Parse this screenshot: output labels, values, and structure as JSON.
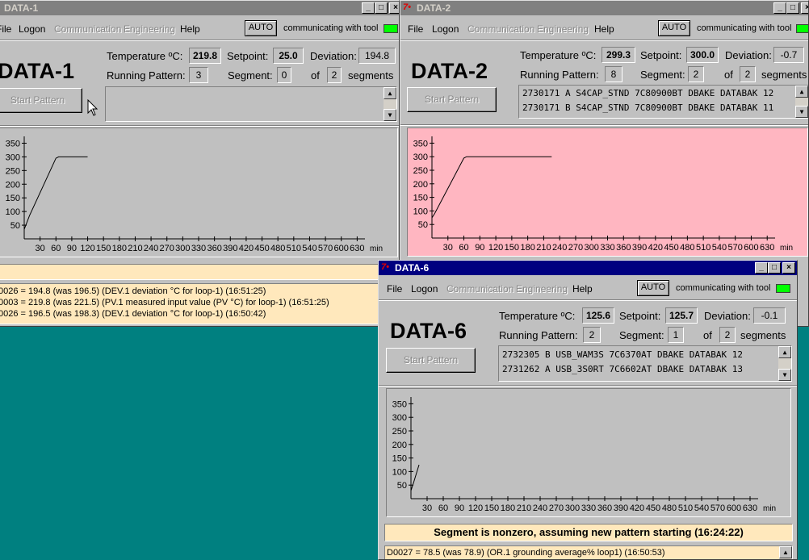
{
  "menu": {
    "file": "File",
    "logon": "Logon",
    "communication": "Communication",
    "engineering": "Engineering",
    "help": "Help"
  },
  "labels": {
    "temperature": "Temperature ºC:",
    "setpoint": "Setpoint:",
    "deviation": "Deviation:",
    "running_pattern": "Running Pattern:",
    "segment": "Segment:",
    "of": "of",
    "segments": "segments",
    "auto": "AUTO",
    "status": "communicating with tool",
    "start_pattern": "Start Pattern"
  },
  "title_buttons": {
    "minimize": "_",
    "maximize": "□",
    "close": "×"
  },
  "window1": {
    "title": "DATA-1",
    "heading": "DATA-1",
    "temperature": "219.8",
    "setpoint": "25.0",
    "deviation": "194.8",
    "running_pattern": "3",
    "segment": "0",
    "of_segments": "2",
    "pattern_rows": [
      "",
      ""
    ],
    "log": [
      "0026 = 194.8 (was 196.5) (DEV.1 deviation °C for loop-1) (16:51:25)",
      "0003 = 219.8 (was 221.5) (PV.1 measured input value (PV °C) for loop-1) (16:51:25)",
      "0026 = 196.5 (was 198.3) (DEV.1 deviation °C for loop-1) (16:50:42)"
    ],
    "chart": {
      "bg": "#c0c0c0",
      "y_ticks": [
        "50",
        "100",
        "150",
        "200",
        "250",
        "300",
        "350"
      ],
      "x_ticks": [
        "30",
        "60",
        "90",
        "120",
        "150",
        "180",
        "210",
        "240",
        "270",
        "300",
        "330",
        "360",
        "390",
        "420",
        "450",
        "480",
        "510",
        "540",
        "570",
        "600",
        "630"
      ],
      "x_unit": "min"
    }
  },
  "window2": {
    "title": "DATA-2",
    "heading": "DATA-2",
    "temperature": "299.3",
    "setpoint": "300.0",
    "deviation": "-0.7",
    "running_pattern": "8",
    "segment": "2",
    "of_segments": "2",
    "pattern_rows": [
      "2730171 A S4CAP_STND 7C80900BT DBAKE DATABAK 12",
      "2730171 B S4CAP_STND 7C80900BT DBAKE DATABAK 11"
    ],
    "chart": {
      "bg": "#ffb6c1",
      "y_ticks": [
        "50",
        "100",
        "150",
        "200",
        "250",
        "300",
        "350"
      ],
      "x_ticks": [
        "30",
        "60",
        "90",
        "120",
        "150",
        "180",
        "210",
        "240",
        "270",
        "300",
        "330",
        "360",
        "390",
        "420",
        "450",
        "480",
        "510",
        "540",
        "570",
        "600",
        "630"
      ],
      "x_unit": "min"
    }
  },
  "window6": {
    "title": "DATA-6",
    "heading": "DATA-6",
    "temperature": "125.6",
    "setpoint": "125.7",
    "deviation": "-0.1",
    "running_pattern": "2",
    "segment": "1",
    "of_segments": "2",
    "pattern_rows": [
      "2732305 B USB_WAM3S 7C6370AT DBAKE DATABAK 12",
      "2731262 A USB_3S0RT 7C6602AT DBAKE DATABAK 13"
    ],
    "banner": "Segment is nonzero, assuming new pattern starting (16:24:22)",
    "log": [
      "D0027 = 78.5 (was 78.9) (OR.1 grounding average% loop1) (16:50:53)"
    ],
    "chart": {
      "bg": "#c0c0c0",
      "y_ticks": [
        "50",
        "100",
        "150",
        "200",
        "250",
        "300",
        "350"
      ],
      "x_ticks": [
        "30",
        "60",
        "90",
        "120",
        "150",
        "180",
        "210",
        "240",
        "270",
        "300",
        "330",
        "360",
        "390",
        "420",
        "450",
        "480",
        "510",
        "540",
        "570",
        "600",
        "630"
      ],
      "x_unit": "min"
    }
  },
  "chart_data": [
    {
      "type": "line",
      "title": "DATA-1",
      "xlabel": "min",
      "ylabel": "",
      "xlim": [
        0,
        660
      ],
      "ylim": [
        0,
        375
      ],
      "series": [
        {
          "x": [
            0,
            10,
            60,
            65,
            120
          ],
          "y": [
            35,
            85,
            295,
            300,
            300
          ]
        }
      ]
    },
    {
      "type": "line",
      "title": "DATA-2",
      "xlabel": "min",
      "ylabel": "",
      "xlim": [
        0,
        660
      ],
      "ylim": [
        0,
        375
      ],
      "series": [
        {
          "x": [
            0,
            5,
            60,
            65,
            225
          ],
          "y": [
            75,
            90,
            295,
            300,
            300
          ]
        }
      ]
    },
    {
      "type": "line",
      "title": "DATA-6",
      "xlabel": "min",
      "ylabel": "",
      "xlim": [
        0,
        660
      ],
      "ylim": [
        0,
        375
      ],
      "series": [
        {
          "x": [
            0,
            5,
            15
          ],
          "y": [
            30,
            60,
            125
          ]
        }
      ]
    }
  ]
}
